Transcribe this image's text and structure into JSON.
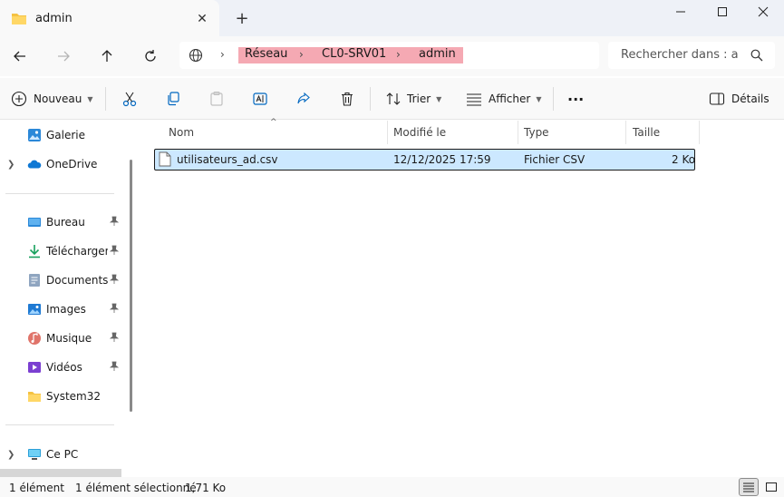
{
  "tab": {
    "title": "admin",
    "close": "✕",
    "new": "+"
  },
  "window": {
    "minimize": "—",
    "maximize": "☐",
    "close": "✕"
  },
  "address": {
    "crumbs": [
      "Réseau",
      "CL0-SRV01",
      "admin"
    ],
    "separator": "›"
  },
  "search": {
    "placeholder": "Rechercher dans : ac"
  },
  "commands": {
    "new_label": "Nouveau",
    "sort_label": "Trier",
    "view_label": "Afficher",
    "more_label": "···",
    "details_label": "Détails"
  },
  "sidebar": {
    "top": [
      {
        "label": "Galerie",
        "icon": "gallery-icon"
      },
      {
        "label": "OneDrive",
        "icon": "onedrive-icon"
      }
    ],
    "quick": [
      {
        "label": "Bureau",
        "icon": "desktop-icon"
      },
      {
        "label": "Téléchargements",
        "icon": "download-icon"
      },
      {
        "label": "Documents",
        "icon": "documents-icon"
      },
      {
        "label": "Images",
        "icon": "images-icon"
      },
      {
        "label": "Musique",
        "icon": "music-icon"
      },
      {
        "label": "Vidéos",
        "icon": "videos-icon"
      },
      {
        "label": "System32",
        "icon": "folder-icon"
      }
    ],
    "bottom": [
      {
        "label": "Ce PC",
        "icon": "pc-icon"
      }
    ]
  },
  "columns": {
    "name": "Nom",
    "modified": "Modifié le",
    "type": "Type",
    "size": "Taille"
  },
  "files": [
    {
      "name": "utilisateurs_ad.csv",
      "modified": "12/12/2025 17:59",
      "type": "Fichier CSV",
      "size": "2 Ko"
    }
  ],
  "status": {
    "count": "1 élément",
    "selection": "1 élément sélectionné",
    "selection_size": "1,71 Ko"
  },
  "colors": {
    "selection_bg": "#cce8ff",
    "crumb_highlight": "#f5a9b3",
    "accent": "#0067c0"
  }
}
